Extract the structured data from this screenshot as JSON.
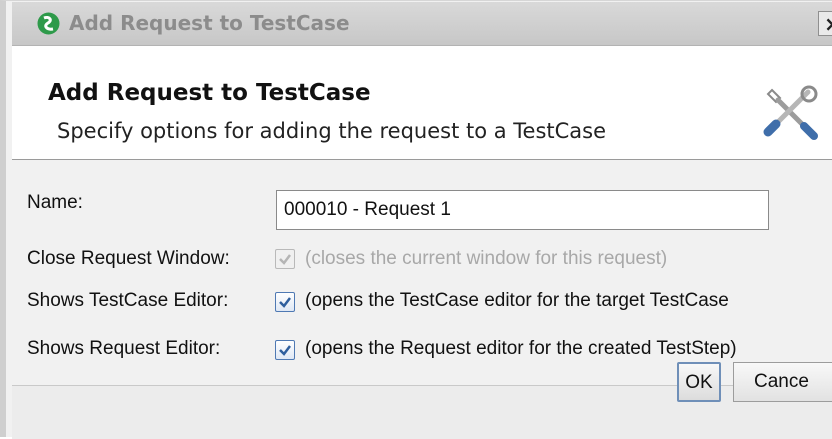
{
  "dialog": {
    "window_title": "Add Request to TestCase",
    "close_glyph": "×",
    "header_title": "Add Request to TestCase",
    "header_subtitle": "Specify options for adding the request to a TestCase",
    "app_icon": "soapui-icon",
    "header_icon": "tools-icon"
  },
  "form": {
    "name_label": "Name:",
    "name_value": "000010 - Request 1",
    "close_window_label": "Close Request Window:",
    "close_window_checked": true,
    "close_window_enabled": false,
    "close_window_desc": "(closes the current window for this request)",
    "shows_testcase_label": "Shows TestCase Editor:",
    "shows_testcase_checked": true,
    "shows_testcase_desc": "(opens the TestCase editor for the target TestCase",
    "shows_request_label": "Shows Request Editor:",
    "shows_request_checked": true,
    "shows_request_desc": "(opens the Request editor for the created TestStep)"
  },
  "buttons": {
    "ok": "OK",
    "cancel": "Cance"
  },
  "colors": {
    "accent": "#4f79b3",
    "app_icon": "#2e9a4a"
  }
}
